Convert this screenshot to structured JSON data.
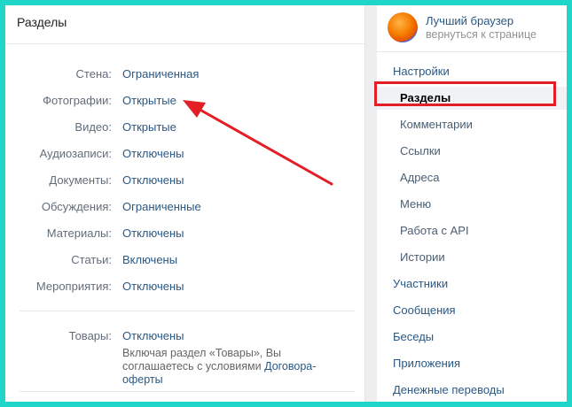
{
  "main": {
    "title": "Разделы",
    "rows": [
      {
        "label": "Стена:",
        "value": "Ограниченная"
      },
      {
        "label": "Фотографии:",
        "value": "Открытые"
      },
      {
        "label": "Видео:",
        "value": "Открытые"
      },
      {
        "label": "Аудиозаписи:",
        "value": "Отключены"
      },
      {
        "label": "Документы:",
        "value": "Отключены"
      },
      {
        "label": "Обсуждения:",
        "value": "Ограниченные"
      },
      {
        "label": "Материалы:",
        "value": "Отключены"
      },
      {
        "label": "Статьи:",
        "value": "Включены"
      },
      {
        "label": "Мероприятия:",
        "value": "Отключены"
      }
    ],
    "goods": {
      "label": "Товары:",
      "value": "Отключены",
      "note_prefix": "Включая раздел «Товары», Вы соглашаетесь с условиями",
      "note_link": "Договора-оферты"
    }
  },
  "sidebar": {
    "profile_name": "Лучший браузер",
    "profile_back": "вернуться к странице",
    "items": [
      {
        "label": "Настройки",
        "level": "top"
      },
      {
        "label": "Разделы",
        "level": "sub",
        "active": true
      },
      {
        "label": "Комментарии",
        "level": "sub"
      },
      {
        "label": "Ссылки",
        "level": "sub"
      },
      {
        "label": "Адреса",
        "level": "sub"
      },
      {
        "label": "Меню",
        "level": "sub"
      },
      {
        "label": "Работа с API",
        "level": "sub"
      },
      {
        "label": "Истории",
        "level": "sub"
      },
      {
        "label": "Участники",
        "level": "top"
      },
      {
        "label": "Сообщения",
        "level": "top"
      },
      {
        "label": "Беседы",
        "level": "top"
      },
      {
        "label": "Приложения",
        "level": "top"
      },
      {
        "label": "Денежные переводы",
        "level": "top"
      }
    ]
  },
  "colors": {
    "frame": "#1fd6c8",
    "link": "#2a5885",
    "label": "#626d7a",
    "annotation": "#e31e24"
  }
}
